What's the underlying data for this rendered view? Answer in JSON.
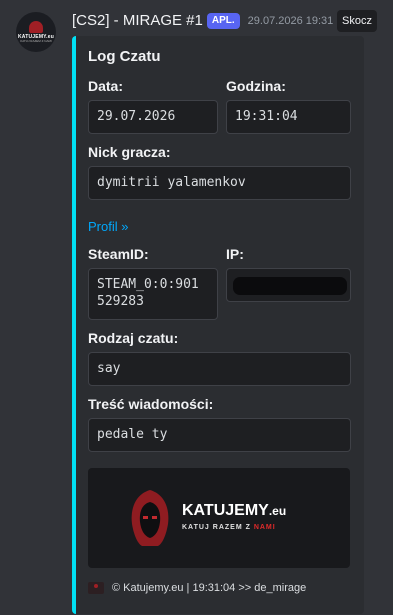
{
  "message": {
    "author": "[CS2] - MIRAGE #1",
    "badge": "APL.",
    "timestamp": "29.07.2026 19:31",
    "jump_label": "Skocz",
    "avatar_text": "KATUJEMY.eu",
    "avatar_subtext": "KATUJ RAZEM Z NAMI"
  },
  "embed": {
    "accent_color": "#00e1f5",
    "title": "Log Czatu",
    "fields": {
      "date": {
        "name": "Data:",
        "value": "29.07.2026"
      },
      "time": {
        "name": "Godzina:",
        "value": "19:31:04"
      },
      "nick": {
        "name": "Nick gracza:",
        "value": "dymitrii yalamenkov"
      },
      "steamid": {
        "name": "SteamID:",
        "value": "STEAM_0:0:901\n529283"
      },
      "ip": {
        "name": "IP:",
        "value": ""
      },
      "chat_type": {
        "name": "Rodzaj czatu:",
        "value": "say"
      },
      "message": {
        "name": "Treść wiadomości:",
        "value": "pedale ty"
      }
    },
    "profile_link": "Profil »",
    "image": {
      "brand": "KATUJEMY",
      "brand_suffix": ".eu",
      "tagline_prefix": "KATUJ RAZEM Z ",
      "tagline_highlight": "NAMI"
    },
    "footer": "© Katujemy.eu | 19:31:04 >> de_mirage"
  }
}
